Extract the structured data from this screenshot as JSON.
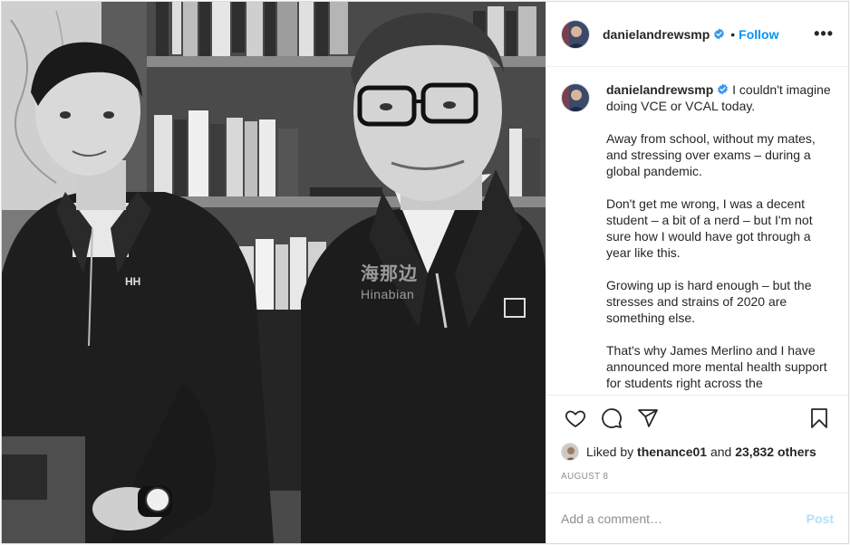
{
  "post": {
    "username": "danielandrewsmp",
    "separator": "•",
    "follow_label": "Follow",
    "more_label": "•••",
    "photo_watermark": {
      "cn": "海那边",
      "en": "Hinabian"
    },
    "logo_text": "HH",
    "caption": {
      "username": "danielandrewsmp",
      "paragraphs": [
        "I couldn't imagine doing VCE or VCAL today.",
        "Away from school, without my mates, and stressing over exams – during a global pandemic.",
        "Don't get me wrong, I was a decent student – a bit of a nerd – but I'm not sure how I would have got through a year like this.",
        "Growing up is hard enough – but the stresses and strains of 2020 are something else.",
        "That's why James Merlino and I have announced more mental health support for students right across the"
      ]
    },
    "likes": {
      "prefix": "Liked by",
      "user": "thenance01",
      "middle": "and",
      "others": "23,832 others"
    },
    "date": "AUGUST 8",
    "comment": {
      "placeholder": "Add a comment…",
      "post_label": "Post"
    },
    "colors": {
      "link_blue": "#0095f6",
      "post_disabled": "#b2dffc",
      "verified_blue": "#3897f0",
      "muted": "#8e8e8e"
    },
    "icons": [
      "heart-icon",
      "comment-icon",
      "share-icon",
      "bookmark-icon",
      "verified-icon",
      "more-icon"
    ]
  }
}
